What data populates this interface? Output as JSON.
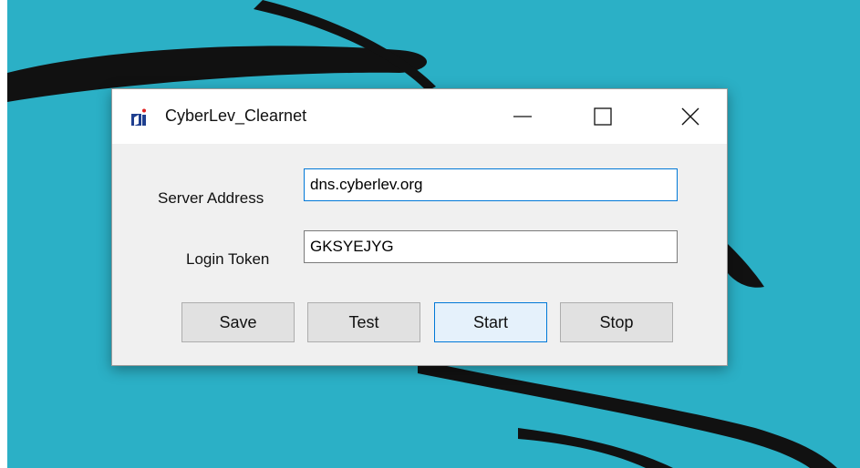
{
  "window": {
    "title": "CyberLev_Clearnet",
    "icon": "app-icon",
    "controls": {
      "minimize": "minimize-icon",
      "maximize": "maximize-icon",
      "close": "close-icon"
    }
  },
  "form": {
    "server_label": "Server Address",
    "server_value": "dns.cyberlev.org",
    "token_label": "Login Token",
    "token_value": "GKSYEJYG"
  },
  "buttons": {
    "save": "Save",
    "test": "Test",
    "start": "Start",
    "stop": "Stop"
  },
  "colors": {
    "desktop": "#2bb0c6",
    "accent": "#0078d7"
  }
}
